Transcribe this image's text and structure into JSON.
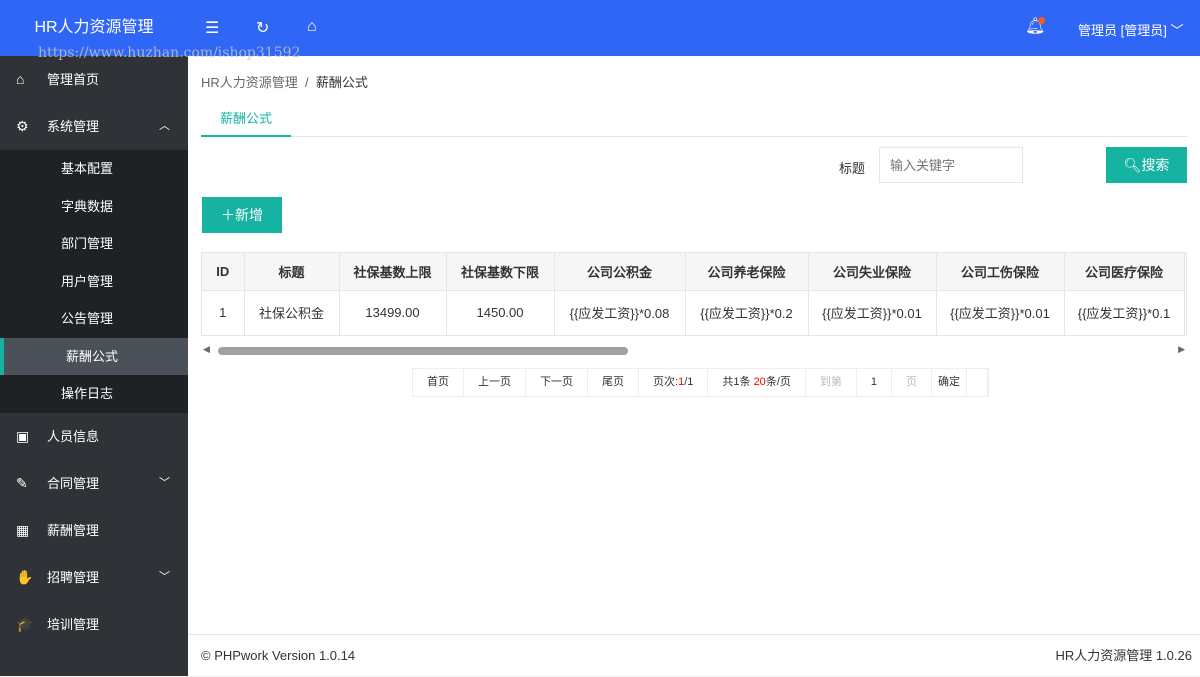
{
  "header": {
    "title": "HR人力资源管理",
    "icons": [
      "menu-fold-icon",
      "refresh-icon",
      "home-icon"
    ],
    "user": "管理员 [管理员]",
    "watermark": "https://www.huzhan.com/ishop31592"
  },
  "sidebar": {
    "items": [
      {
        "label": "管理首页",
        "icon": "⌂"
      },
      {
        "label": "系统管理",
        "icon": "⚙",
        "arrow": "︿",
        "children": [
          "基本配置",
          "字典数据",
          "部门管理",
          "用户管理",
          "公告管理",
          "薪酬公式",
          "操作日志"
        ]
      },
      {
        "label": "人员信息",
        "icon": "▣"
      },
      {
        "label": "合同管理",
        "icon": "✎",
        "arrow": "﹀"
      },
      {
        "label": "薪酬管理",
        "icon": "▦"
      },
      {
        "label": "招聘管理",
        "icon": "✋",
        "arrow": "﹀"
      },
      {
        "label": "培训管理",
        "icon": "🎓"
      }
    ],
    "active_child": "薪酬公式"
  },
  "breadcrumb": {
    "root": "HR人力资源管理",
    "sep": "/",
    "current": "薪酬公式"
  },
  "tab": "薪酬公式",
  "search": {
    "label": "标题",
    "placeholder": "输入关键字",
    "button": "搜索"
  },
  "add_button": "新增",
  "table": {
    "columns": [
      "ID",
      "标题",
      "社保基数上限",
      "社保基数下限",
      "公司公积金",
      "公司养老保险",
      "公司失业保险",
      "公司工伤保险",
      "公司医疗保险"
    ],
    "rows": [
      [
        "1",
        "社保公积金",
        "13499.00",
        "1450.00",
        "{{应发工资}}*0.08",
        "{{应发工资}}*0.2",
        "{{应发工资}}*0.01",
        "{{应发工资}}*0.01",
        "{{应发工资}}*0.1"
      ]
    ]
  },
  "pagination": {
    "first": "首页",
    "prev": "上一页",
    "next": "下一页",
    "last": "尾页",
    "page_label": "页次:",
    "page_current": "1",
    "page_total": "/1",
    "total_prefix": "共1条 ",
    "per_page": "20",
    "per_page_suffix": "条/页",
    "goto": "到第",
    "goto_value": "1",
    "page_unit": "页",
    "confirm": "确定"
  },
  "footer": {
    "left": "© PHPwork Version 1.0.14",
    "right": "HR人力资源管理 1.0.26"
  }
}
